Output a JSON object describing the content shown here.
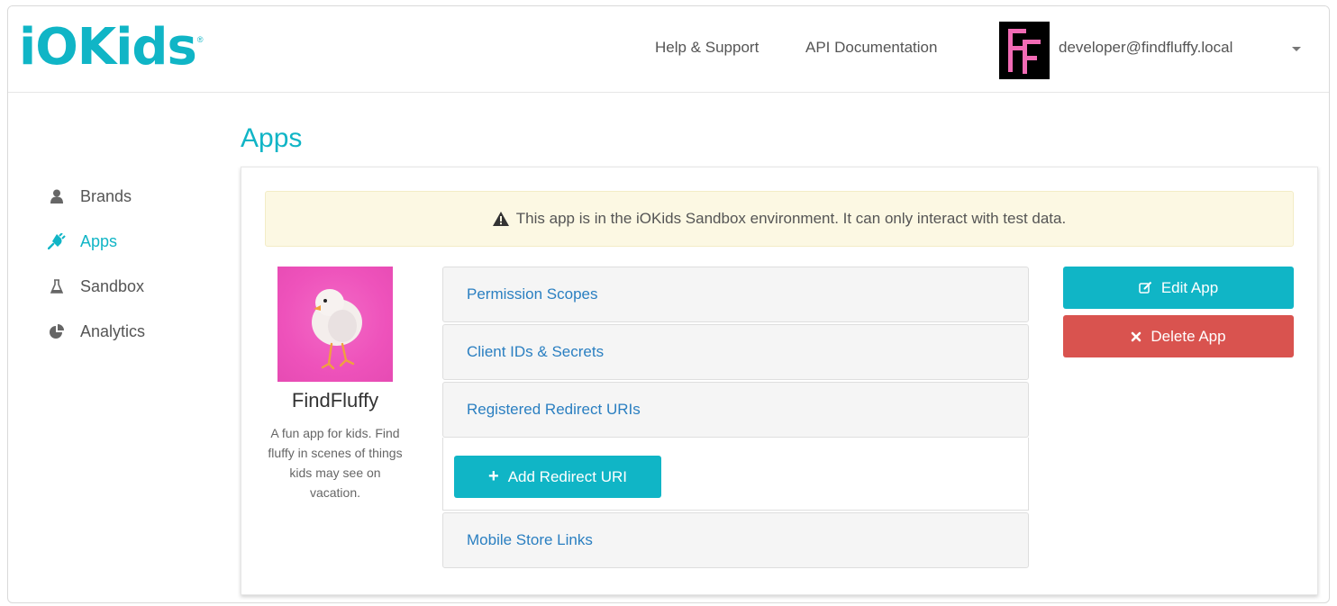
{
  "header": {
    "logo_text": "iOKids",
    "logo_mark": "®",
    "nav": [
      {
        "label": "Help & Support"
      },
      {
        "label": "API Documentation"
      }
    ],
    "avatar_initials": "FF",
    "user_email": "developer@findfluffy.local"
  },
  "sidebar": {
    "items": [
      {
        "label": "Brands",
        "icon": "user-icon",
        "active": false
      },
      {
        "label": "Apps",
        "icon": "plug-icon",
        "active": true
      },
      {
        "label": "Sandbox",
        "icon": "flask-icon",
        "active": false
      },
      {
        "label": "Analytics",
        "icon": "pie-chart-icon",
        "active": false
      }
    ]
  },
  "main": {
    "title": "Apps",
    "alert": "This app is in the iOKids Sandbox environment. It can only interact with test data.",
    "app": {
      "name": "FindFluffy",
      "description": "A fun app for kids. Find fluffy in scenes of things kids may see on vacation."
    },
    "sections": [
      {
        "label": "Permission Scopes"
      },
      {
        "label": "Client IDs & Secrets"
      },
      {
        "label": "Registered Redirect URIs"
      },
      {
        "label": "Mobile Store Links"
      }
    ],
    "add_redirect_label": "Add Redirect URI",
    "edit_label": "Edit App",
    "delete_label": "Delete App"
  },
  "colors": {
    "accent": "#10b5c6",
    "danger": "#d9534f",
    "link": "#2a7fc1",
    "alert_bg": "#fcf8e3",
    "thumb_bg": "#ee52bb"
  }
}
